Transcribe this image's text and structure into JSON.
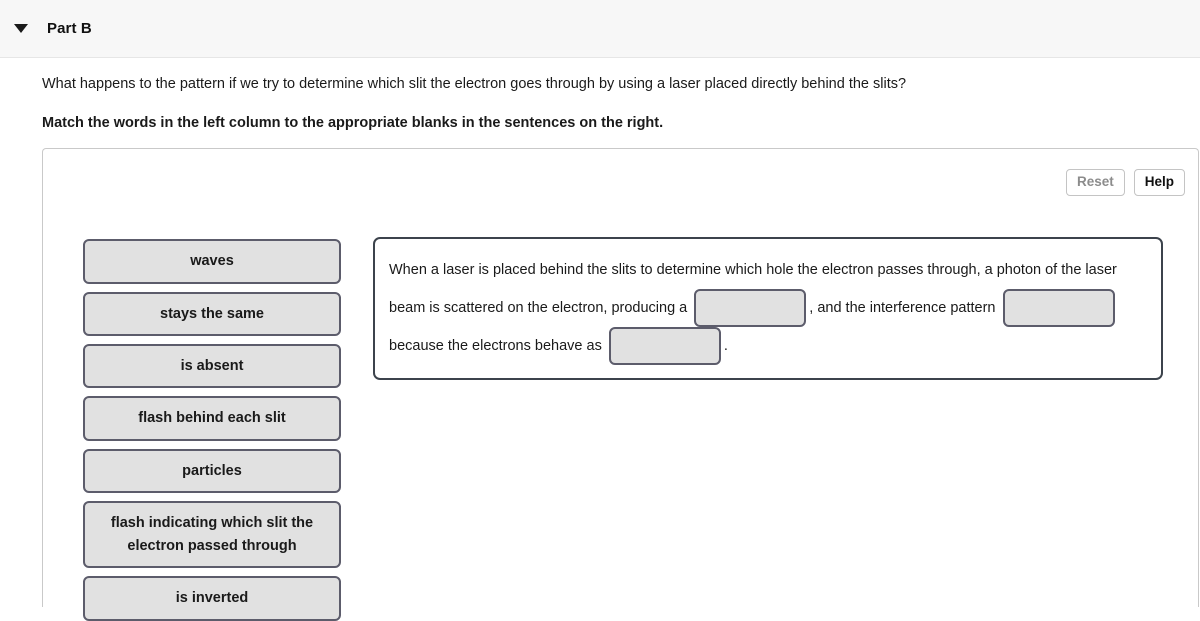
{
  "header": {
    "title": "Part B",
    "collapse_icon": "triangle-down-icon"
  },
  "question": {
    "prompt": "What happens to the pattern if we try to determine which slit the electron goes through by using a laser placed directly behind the slits?",
    "instruction": "Match the words in the left column to the appropriate blanks in the sentences on the right."
  },
  "toolbar": {
    "reset_label": "Reset",
    "help_label": "Help"
  },
  "word_bank": {
    "tiles": [
      {
        "label": "waves"
      },
      {
        "label": "stays the same"
      },
      {
        "label": "is absent"
      },
      {
        "label": "flash behind each slit"
      },
      {
        "label": "particles"
      },
      {
        "label": "flash indicating which slit the electron passed through"
      },
      {
        "label": "is inverted"
      }
    ]
  },
  "sentence": {
    "segment_1": "When a laser is placed behind the slits to determine which hole the electron passes through, a photon of the laser beam is scattered on the electron, producing a ",
    "blank_1": "",
    "segment_2": ", and the interference pattern ",
    "blank_2": "",
    "segment_3": " because the electrons behave as ",
    "blank_3": "",
    "segment_4": "."
  },
  "colors": {
    "header_background": "#f7f7f7",
    "tile_fill": "#e1e1e1",
    "tile_border": "#5c5c6b",
    "sentence_border": "#3c434c",
    "panel_border": "#c9c9c9",
    "reset_text": "#8c8c8c",
    "help_text": "#111111"
  }
}
